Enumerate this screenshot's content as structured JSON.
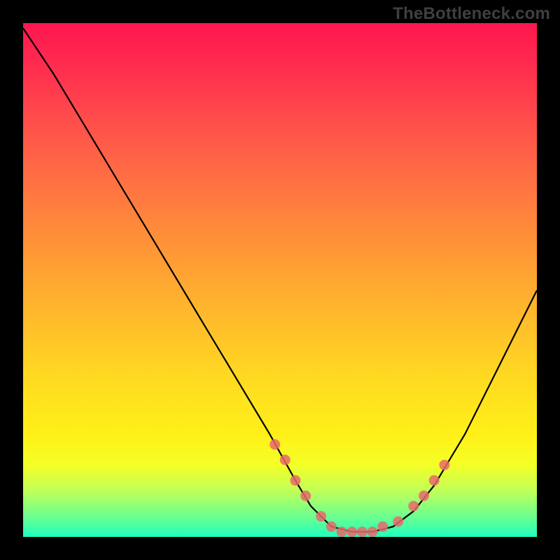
{
  "watermark": "TheBottleneck.com",
  "chart_data": {
    "type": "line",
    "title": "",
    "xlabel": "",
    "ylabel": "",
    "xlim": [
      0,
      100
    ],
    "ylim": [
      0,
      100
    ],
    "curve": {
      "x": [
        0,
        6,
        12,
        18,
        24,
        30,
        36,
        42,
        48,
        53,
        56,
        60,
        64,
        68,
        72,
        76,
        80,
        86,
        92,
        100
      ],
      "y": [
        99,
        90,
        80,
        70,
        60,
        50,
        40,
        30,
        20,
        11,
        6,
        2,
        1,
        1,
        2,
        5,
        10,
        20,
        32,
        48
      ]
    },
    "markers": {
      "x": [
        49,
        51,
        53,
        55,
        58,
        60,
        62,
        64,
        66,
        68,
        70,
        73,
        76,
        78,
        80,
        82
      ],
      "y": [
        18,
        15,
        11,
        8,
        4,
        2,
        1,
        1,
        1,
        1,
        2,
        3,
        6,
        8,
        11,
        14
      ]
    },
    "gradient_stops": [
      {
        "pct": 0,
        "color": "#ff1750"
      },
      {
        "pct": 50,
        "color": "#ffc028"
      },
      {
        "pct": 85,
        "color": "#f0ff20"
      },
      {
        "pct": 100,
        "color": "#1effc0"
      }
    ],
    "marker_color": "#e86a6a",
    "curve_color": "#000000"
  }
}
